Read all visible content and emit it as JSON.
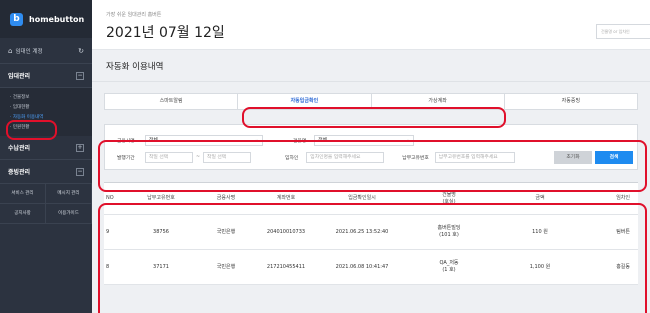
{
  "brand": {
    "name": "homebutton",
    "logo": "b"
  },
  "account": {
    "label": "임대인 계정",
    "home_icon": "home-icon",
    "refresh_icon": "refresh-icon"
  },
  "sidebar": {
    "section_rental": "임대관리",
    "rental_items": [
      "· 건물정보",
      "· 임대현황",
      "· 자동화 이용내역",
      "· 민원현황"
    ],
    "section_income": "수납관리",
    "section_tax": "증빙관리",
    "buttons": [
      "서비스 관리",
      "메시지 관리",
      "공지사항",
      "이용가이드"
    ]
  },
  "header": {
    "tagline": "가장 쉬운 임대관리 홈버튼",
    "date": "2021년 07월 12일",
    "search_placeholder": "건물명 or 임차인"
  },
  "page_title": "자동화 이용내역",
  "tabs": [
    {
      "label": "스마트알림",
      "active": false
    },
    {
      "label": "자동입금확인",
      "active": true
    },
    {
      "label": "가상계좌",
      "active": false
    },
    {
      "label": "자동증빙",
      "active": false
    }
  ],
  "filter": {
    "bank_label": "금융사명",
    "bank_value": "전체",
    "building_label": "건물명",
    "building_value": "전체",
    "period_label": "발행기간",
    "start_placeholder": "착일 선택",
    "range_sep": "~",
    "end_placeholder": "착일 선택",
    "tenant_label": "임차인",
    "tenant_placeholder": "임차인명을 입력해주세요",
    "tax_label": "납부고유번호",
    "tax_placeholder": "납부고유번호를 입력해주세요",
    "reset_label": "초기화",
    "search_label": "검색"
  },
  "table": {
    "columns": [
      "NO",
      "납부고유번호",
      "금융사명",
      "계좌번호",
      "입금확인일시",
      "건물명\n(호실)",
      "금액",
      "임차인"
    ],
    "rows": [
      {
        "no": "9",
        "tax_no": "38756",
        "bank": "국민은행",
        "account": "204010010733",
        "datetime": "2021.06.25 13:52:40",
        "building": "홈버튼빌딩",
        "unit": "(101 호)",
        "amount": "110 원",
        "tenant": "팀버튼"
      },
      {
        "no": "8",
        "tax_no": "37171",
        "bank": "국민은행",
        "account": "217210455411",
        "datetime": "2021.06.08 10:41:47",
        "building": "QA_저동",
        "unit": "(1 호)",
        "amount": "1,100 원",
        "tenant": "홍길동"
      }
    ]
  },
  "colors": {
    "accent": "#1e8bf0",
    "highlight": "#e0102b",
    "sidebar_bg": "#2c3340"
  }
}
